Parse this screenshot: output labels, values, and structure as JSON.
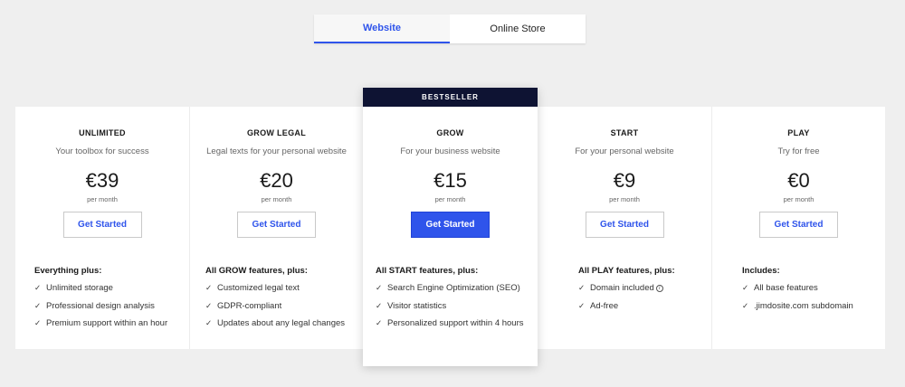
{
  "tabs": [
    "Website",
    "Online Store"
  ],
  "active_tab": "Website",
  "colors": {
    "accent": "#2f54eb",
    "badge_bg": "#0e1333",
    "page_bg": "#efefef"
  },
  "plans": [
    {
      "name": "UNLIMITED",
      "subtitle": "Your toolbox for success",
      "price": "€39",
      "period": "per month",
      "cta": "Get Started",
      "features_heading": "Everything plus:",
      "features": [
        "Unlimited storage",
        "Professional design analysis",
        "Premium support within an hour"
      ]
    },
    {
      "name": "GROW LEGAL",
      "subtitle": "Legal texts for your personal website",
      "price": "€20",
      "period": "per month",
      "cta": "Get Started",
      "features_heading": "All GROW features, plus:",
      "features": [
        "Customized legal text",
        "GDPR-compliant",
        "Updates about any legal changes"
      ]
    },
    {
      "name": "GROW",
      "badge": "BESTSELLER",
      "subtitle": "For your business website",
      "price": "€15",
      "period": "per month",
      "cta": "Get Started",
      "features_heading": "All START features, plus:",
      "features": [
        "Search Engine Optimization (SEO)",
        "Visitor statistics",
        "Personalized support within 4 hours"
      ]
    },
    {
      "name": "START",
      "subtitle": "For your personal website",
      "price": "€9",
      "period": "per month",
      "cta": "Get Started",
      "features_heading": "All PLAY features, plus:",
      "features": [
        "Domain included",
        "Ad-free"
      ]
    },
    {
      "name": "PLAY",
      "subtitle": "Try for free",
      "price": "€0",
      "period": "per month",
      "cta": "Get Started",
      "features_heading": "Includes:",
      "features": [
        "All base features",
        ".jimdosite.com subdomain"
      ]
    }
  ],
  "check_glyph": "✓",
  "info_glyph": "i"
}
